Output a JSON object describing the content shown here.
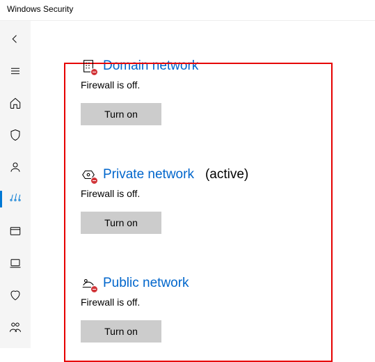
{
  "title": "Windows Security",
  "sidebar": {
    "items": [
      {
        "name": "back"
      },
      {
        "name": "menu"
      },
      {
        "name": "home"
      },
      {
        "name": "virus"
      },
      {
        "name": "account"
      },
      {
        "name": "firewall"
      },
      {
        "name": "app-browser"
      },
      {
        "name": "device-security"
      },
      {
        "name": "device-health"
      },
      {
        "name": "family"
      }
    ],
    "selected": "firewall"
  },
  "networks": [
    {
      "icon": "building",
      "title": "Domain network",
      "active": false,
      "status": "Firewall is off.",
      "button": "Turn on"
    },
    {
      "icon": "private",
      "title": "Private network",
      "active": true,
      "active_label": "(active)",
      "status": "Firewall is off.",
      "button": "Turn on"
    },
    {
      "icon": "public",
      "title": "Public network",
      "active": false,
      "status": "Firewall is off.",
      "button": "Turn on"
    }
  ]
}
